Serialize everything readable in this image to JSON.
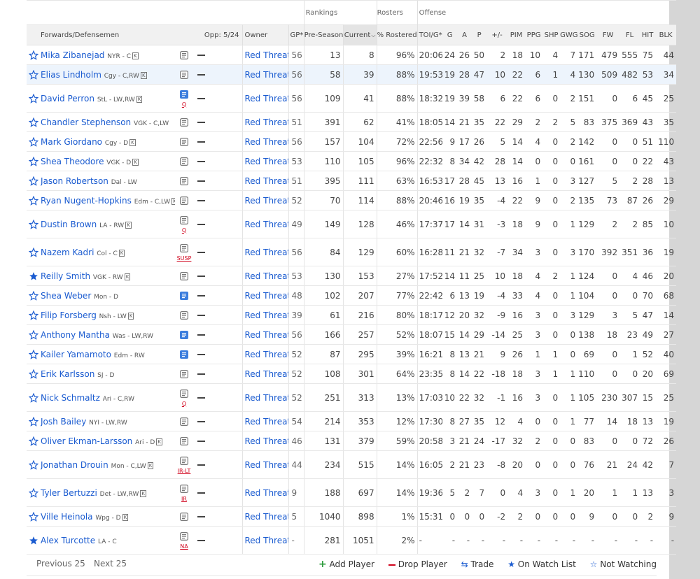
{
  "group_headers": {
    "rankings": "Rankings",
    "rosters": "Rosters",
    "offense": "Offense"
  },
  "columns": {
    "player": "Forwards/Defensemen",
    "opp": "Opp: 5/24",
    "owner": "Owner",
    "gp": "GP*",
    "preseason": "Pre-Season",
    "current": "Current",
    "rostered": "% Rostered",
    "toi": "TOI/G*",
    "g": "G",
    "a": "A",
    "p": "P",
    "pm": "+/-",
    "pim": "PIM",
    "ppg": "PPG",
    "shp": "SHP",
    "gwg": "GWG",
    "sog": "SOG",
    "fw": "FW",
    "fl": "FL",
    "hit": "HIT",
    "blk": "BLK"
  },
  "colors": {
    "link": "#1a5bd0",
    "status": "#d0021b",
    "add": "#2a9a3a",
    "drop": "#d0021b",
    "highlight": "#edf4fc"
  },
  "players": [
    {
      "name": "Mika Zibanejad",
      "team": "NYR - C",
      "k": true,
      "star": "outline",
      "note": "plain",
      "status": "",
      "owner": "Red Threat",
      "gp": "56",
      "pre": "13",
      "cur": "8",
      "pct": "96%",
      "toi": "20:06",
      "g": "24",
      "a": "26",
      "p": "50",
      "pm": "2",
      "pim": "18",
      "ppg": "10",
      "shp": "4",
      "gwg": "7",
      "sog": "171",
      "fw": "479",
      "fl": "555",
      "hit": "75",
      "blk": "44"
    },
    {
      "name": "Elias Lindholm",
      "team": "Cgy - C,RW",
      "k": true,
      "star": "outline",
      "note": "plain",
      "status": "",
      "owner": "Red Threat",
      "gp": "56",
      "pre": "58",
      "cur": "39",
      "pct": "88%",
      "toi": "19:53",
      "g": "19",
      "a": "28",
      "p": "47",
      "pm": "10",
      "pim": "22",
      "ppg": "6",
      "shp": "1",
      "gwg": "4",
      "sog": "130",
      "fw": "509",
      "fl": "482",
      "hit": "53",
      "blk": "34",
      "hl": true
    },
    {
      "name": "David Perron",
      "team": "StL - LW,RW",
      "k": true,
      "star": "outline",
      "note": "blue",
      "status": "Q",
      "owner": "Red Threat",
      "gp": "56",
      "pre": "109",
      "cur": "41",
      "pct": "88%",
      "toi": "18:32",
      "g": "19",
      "a": "39",
      "p": "58",
      "pm": "6",
      "pim": "22",
      "ppg": "6",
      "shp": "0",
      "gwg": "2",
      "sog": "151",
      "fw": "0",
      "fl": "6",
      "hit": "45",
      "blk": "25"
    },
    {
      "name": "Chandler Stephenson",
      "team": "VGK - C,LW",
      "k": false,
      "star": "outline",
      "note": "plain",
      "status": "",
      "owner": "Red Threat",
      "gp": "51",
      "pre": "391",
      "cur": "62",
      "pct": "41%",
      "toi": "18:05",
      "g": "14",
      "a": "21",
      "p": "35",
      "pm": "22",
      "pim": "29",
      "ppg": "2",
      "shp": "2",
      "gwg": "5",
      "sog": "83",
      "fw": "375",
      "fl": "369",
      "hit": "43",
      "blk": "35"
    },
    {
      "name": "Mark Giordano",
      "team": "Cgy - D",
      "k": true,
      "star": "outline",
      "note": "plain",
      "status": "",
      "owner": "Red Threat",
      "gp": "56",
      "pre": "157",
      "cur": "104",
      "pct": "72%",
      "toi": "22:56",
      "g": "9",
      "a": "17",
      "p": "26",
      "pm": "5",
      "pim": "14",
      "ppg": "4",
      "shp": "0",
      "gwg": "2",
      "sog": "142",
      "fw": "0",
      "fl": "0",
      "hit": "51",
      "blk": "110"
    },
    {
      "name": "Shea Theodore",
      "team": "VGK - D",
      "k": true,
      "star": "outline",
      "note": "plain",
      "status": "",
      "owner": "Red Threat",
      "gp": "53",
      "pre": "110",
      "cur": "105",
      "pct": "96%",
      "toi": "22:32",
      "g": "8",
      "a": "34",
      "p": "42",
      "pm": "28",
      "pim": "14",
      "ppg": "0",
      "shp": "0",
      "gwg": "0",
      "sog": "161",
      "fw": "0",
      "fl": "0",
      "hit": "22",
      "blk": "43"
    },
    {
      "name": "Jason Robertson",
      "team": "Dal - LW",
      "k": false,
      "star": "outline",
      "note": "plain",
      "status": "",
      "owner": "Red Threat",
      "gp": "51",
      "pre": "395",
      "cur": "111",
      "pct": "63%",
      "toi": "16:53",
      "g": "17",
      "a": "28",
      "p": "45",
      "pm": "13",
      "pim": "16",
      "ppg": "1",
      "shp": "0",
      "gwg": "3",
      "sog": "127",
      "fw": "5",
      "fl": "2",
      "hit": "28",
      "blk": "13"
    },
    {
      "name": "Ryan Nugent-Hopkins",
      "team": "Edm - C,LW",
      "k": true,
      "star": "outline",
      "note": "plain",
      "status": "",
      "owner": "Red Threat",
      "gp": "52",
      "pre": "70",
      "cur": "114",
      "pct": "88%",
      "toi": "20:46",
      "g": "16",
      "a": "19",
      "p": "35",
      "pm": "-4",
      "pim": "22",
      "ppg": "9",
      "shp": "0",
      "gwg": "2",
      "sog": "135",
      "fw": "73",
      "fl": "87",
      "hit": "26",
      "blk": "29"
    },
    {
      "name": "Dustin Brown",
      "team": "LA - RW",
      "k": true,
      "star": "outline",
      "note": "plain",
      "status": "Q",
      "owner": "Red Threat",
      "gp": "49",
      "pre": "149",
      "cur": "128",
      "pct": "46%",
      "toi": "17:37",
      "g": "17",
      "a": "14",
      "p": "31",
      "pm": "-3",
      "pim": "18",
      "ppg": "9",
      "shp": "0",
      "gwg": "1",
      "sog": "129",
      "fw": "2",
      "fl": "2",
      "hit": "85",
      "blk": "10"
    },
    {
      "name": "Nazem Kadri",
      "team": "Col - C",
      "k": true,
      "star": "outline",
      "note": "plain",
      "status": "SUSP",
      "owner": "Red Threat",
      "gp": "56",
      "pre": "84",
      "cur": "129",
      "pct": "60%",
      "toi": "16:28",
      "g": "11",
      "a": "21",
      "p": "32",
      "pm": "-7",
      "pim": "34",
      "ppg": "3",
      "shp": "0",
      "gwg": "3",
      "sog": "170",
      "fw": "392",
      "fl": "351",
      "hit": "36",
      "blk": "19"
    },
    {
      "name": "Reilly Smith",
      "team": "VGK - RW",
      "k": true,
      "star": "filled",
      "note": "plain",
      "status": "",
      "owner": "Red Threat",
      "gp": "53",
      "pre": "130",
      "cur": "153",
      "pct": "27%",
      "toi": "17:52",
      "g": "14",
      "a": "11",
      "p": "25",
      "pm": "10",
      "pim": "18",
      "ppg": "4",
      "shp": "2",
      "gwg": "1",
      "sog": "124",
      "fw": "0",
      "fl": "4",
      "hit": "46",
      "blk": "20"
    },
    {
      "name": "Shea Weber",
      "team": "Mon - D",
      "k": false,
      "star": "outline",
      "note": "blue",
      "status": "",
      "owner": "Red Threat",
      "gp": "48",
      "pre": "102",
      "cur": "207",
      "pct": "77%",
      "toi": "22:42",
      "g": "6",
      "a": "13",
      "p": "19",
      "pm": "-4",
      "pim": "33",
      "ppg": "4",
      "shp": "0",
      "gwg": "1",
      "sog": "104",
      "fw": "0",
      "fl": "0",
      "hit": "70",
      "blk": "68"
    },
    {
      "name": "Filip Forsberg",
      "team": "Nsh - LW",
      "k": true,
      "star": "outline",
      "note": "plain",
      "status": "",
      "owner": "Red Threat",
      "gp": "39",
      "pre": "61",
      "cur": "216",
      "pct": "80%",
      "toi": "18:17",
      "g": "12",
      "a": "20",
      "p": "32",
      "pm": "-9",
      "pim": "16",
      "ppg": "3",
      "shp": "0",
      "gwg": "3",
      "sog": "129",
      "fw": "3",
      "fl": "5",
      "hit": "47",
      "blk": "14"
    },
    {
      "name": "Anthony Mantha",
      "team": "Was - LW,RW",
      "k": false,
      "star": "outline",
      "note": "blue",
      "status": "",
      "owner": "Red Threat",
      "gp": "56",
      "pre": "166",
      "cur": "257",
      "pct": "52%",
      "toi": "18:07",
      "g": "15",
      "a": "14",
      "p": "29",
      "pm": "-14",
      "pim": "25",
      "ppg": "3",
      "shp": "0",
      "gwg": "0",
      "sog": "138",
      "fw": "18",
      "fl": "23",
      "hit": "49",
      "blk": "27"
    },
    {
      "name": "Kailer Yamamoto",
      "team": "Edm - RW",
      "k": false,
      "star": "outline",
      "note": "blue",
      "status": "",
      "owner": "Red Threat",
      "gp": "52",
      "pre": "87",
      "cur": "295",
      "pct": "39%",
      "toi": "16:21",
      "g": "8",
      "a": "13",
      "p": "21",
      "pm": "9",
      "pim": "26",
      "ppg": "1",
      "shp": "1",
      "gwg": "0",
      "sog": "69",
      "fw": "0",
      "fl": "1",
      "hit": "52",
      "blk": "40"
    },
    {
      "name": "Erik Karlsson",
      "team": "SJ - D",
      "k": false,
      "star": "outline",
      "note": "plain",
      "status": "",
      "owner": "Red Threat",
      "gp": "52",
      "pre": "108",
      "cur": "301",
      "pct": "64%",
      "toi": "23:35",
      "g": "8",
      "a": "14",
      "p": "22",
      "pm": "-18",
      "pim": "18",
      "ppg": "3",
      "shp": "1",
      "gwg": "1",
      "sog": "110",
      "fw": "0",
      "fl": "0",
      "hit": "20",
      "blk": "69"
    },
    {
      "name": "Nick Schmaltz",
      "team": "Ari - C,RW",
      "k": false,
      "star": "outline",
      "note": "plain",
      "status": "Q",
      "owner": "Red Threat",
      "gp": "52",
      "pre": "251",
      "cur": "313",
      "pct": "13%",
      "toi": "17:03",
      "g": "10",
      "a": "22",
      "p": "32",
      "pm": "-1",
      "pim": "16",
      "ppg": "3",
      "shp": "0",
      "gwg": "1",
      "sog": "105",
      "fw": "230",
      "fl": "307",
      "hit": "15",
      "blk": "25"
    },
    {
      "name": "Josh Bailey",
      "team": "NYI - LW,RW",
      "k": false,
      "star": "outline",
      "note": "plain",
      "status": "",
      "owner": "Red Threat",
      "gp": "54",
      "pre": "214",
      "cur": "353",
      "pct": "12%",
      "toi": "17:30",
      "g": "8",
      "a": "27",
      "p": "35",
      "pm": "12",
      "pim": "4",
      "ppg": "0",
      "shp": "0",
      "gwg": "1",
      "sog": "77",
      "fw": "14",
      "fl": "18",
      "hit": "13",
      "blk": "19"
    },
    {
      "name": "Oliver Ekman-Larsson",
      "team": "Ari - D",
      "k": true,
      "star": "outline",
      "note": "plain",
      "status": "",
      "owner": "Red Threat",
      "gp": "46",
      "pre": "131",
      "cur": "379",
      "pct": "59%",
      "toi": "20:58",
      "g": "3",
      "a": "21",
      "p": "24",
      "pm": "-17",
      "pim": "32",
      "ppg": "2",
      "shp": "0",
      "gwg": "0",
      "sog": "83",
      "fw": "0",
      "fl": "0",
      "hit": "72",
      "blk": "26"
    },
    {
      "name": "Jonathan Drouin",
      "team": "Mon - C,LW",
      "k": true,
      "star": "outline",
      "note": "plain",
      "status": "IR-LT",
      "owner": "Red Threat",
      "gp": "44",
      "pre": "234",
      "cur": "515",
      "pct": "14%",
      "toi": "16:05",
      "g": "2",
      "a": "21",
      "p": "23",
      "pm": "-8",
      "pim": "20",
      "ppg": "0",
      "shp": "0",
      "gwg": "0",
      "sog": "76",
      "fw": "21",
      "fl": "24",
      "hit": "42",
      "blk": "7"
    },
    {
      "name": "Tyler Bertuzzi",
      "team": "Det - LW,RW",
      "k": true,
      "star": "outline",
      "note": "plain",
      "status": "IR",
      "owner": "Red Threat",
      "gp": "9",
      "pre": "188",
      "cur": "697",
      "pct": "14%",
      "toi": "19:36",
      "g": "5",
      "a": "2",
      "p": "7",
      "pm": "0",
      "pim": "4",
      "ppg": "3",
      "shp": "0",
      "gwg": "1",
      "sog": "20",
      "fw": "1",
      "fl": "1",
      "hit": "13",
      "blk": "3"
    },
    {
      "name": "Ville Heinola",
      "team": "Wpg - D",
      "k": true,
      "star": "outline",
      "note": "plain",
      "status": "",
      "owner": "Red Threat",
      "gp": "5",
      "pre": "1040",
      "cur": "898",
      "pct": "1%",
      "toi": "15:31",
      "g": "0",
      "a": "0",
      "p": "0",
      "pm": "-2",
      "pim": "2",
      "ppg": "0",
      "shp": "0",
      "gwg": "0",
      "sog": "9",
      "fw": "0",
      "fl": "0",
      "hit": "2",
      "blk": "9"
    },
    {
      "name": "Alex Turcotte",
      "team": "LA - C",
      "k": false,
      "star": "filled",
      "note": "plain",
      "status": "NA",
      "owner": "Red Threat",
      "gp": "-",
      "pre": "281",
      "cur": "1051",
      "pct": "2%",
      "toi": "-",
      "g": "-",
      "a": "-",
      "p": "-",
      "pm": "-",
      "pim": "-",
      "ppg": "-",
      "shp": "-",
      "gwg": "-",
      "sog": "-",
      "fw": "-",
      "fl": "-",
      "hit": "-",
      "blk": "-"
    }
  ],
  "footer": {
    "prev": "Previous 25",
    "next": "Next 25",
    "add_player": "Add Player",
    "drop_player": "Drop Player",
    "trade": "Trade",
    "on_watch_list": "On Watch List",
    "not_watching": "Not Watching"
  }
}
